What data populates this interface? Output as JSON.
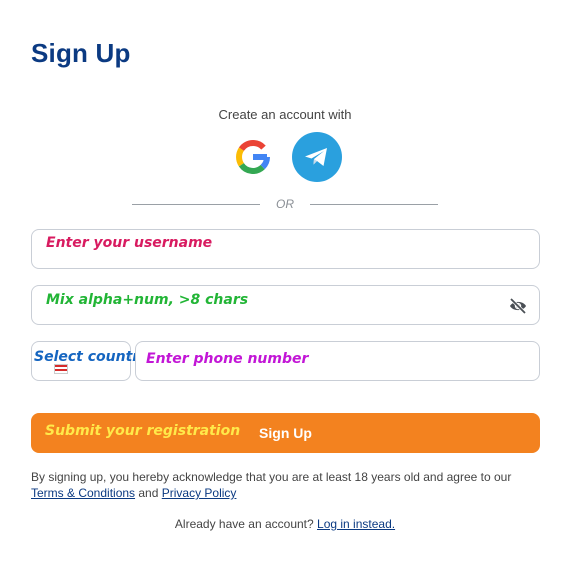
{
  "page": {
    "title": "Sign Up",
    "social_prompt": "Create an account with",
    "divider_text": "OR"
  },
  "social": {
    "google_icon": "google-icon",
    "telegram_icon": "telegram-icon",
    "telegram_color": "#2aa0de"
  },
  "form": {
    "username": {
      "value": "",
      "annotation": "Enter your username"
    },
    "password": {
      "value": "",
      "annotation": "Mix alpha+num, >8 chars",
      "toggle_icon": "eye-off-icon"
    },
    "country": {
      "value": "",
      "annotation": "Select country code"
    },
    "phone": {
      "value": "",
      "annotation": "Enter phone number"
    },
    "submit": {
      "label": "Sign Up",
      "annotation": "Submit your registration",
      "color": "#f3821f"
    }
  },
  "legal": {
    "text_before": "By signing up, you hereby acknowledge that you are at least 18 years old and agree to our ",
    "terms_link": "Terms & Conditions",
    "and_text": " and ",
    "privacy_link": "Privacy Policy"
  },
  "login": {
    "prompt": "Already have an account? ",
    "link": "Log in instead."
  },
  "colors": {
    "title": "#0b3a82",
    "accent": "#f3821f"
  }
}
